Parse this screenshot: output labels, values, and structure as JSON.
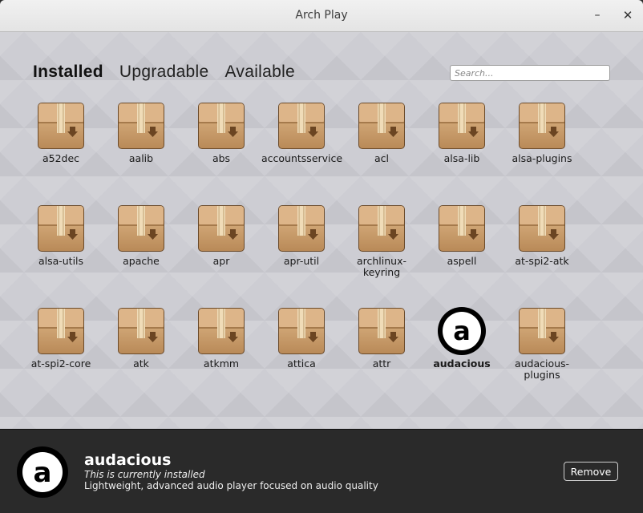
{
  "window": {
    "title": "Arch Play",
    "minimize_label": "–",
    "close_label": "✕"
  },
  "tabs": [
    {
      "label": "Installed",
      "active": true
    },
    {
      "label": "Upgradable",
      "active": false
    },
    {
      "label": "Available",
      "active": false
    }
  ],
  "search": {
    "placeholder": "Search..."
  },
  "packages": [
    {
      "name": "a52dec",
      "icon": "package-box-icon"
    },
    {
      "name": "aalib",
      "icon": "package-box-icon"
    },
    {
      "name": "abs",
      "icon": "package-box-icon"
    },
    {
      "name": "accountsservice",
      "icon": "package-box-icon"
    },
    {
      "name": "acl",
      "icon": "package-box-icon"
    },
    {
      "name": "alsa-lib",
      "icon": "package-box-icon"
    },
    {
      "name": "alsa-plugins",
      "icon": "package-box-icon"
    },
    {
      "name": "alsa-utils",
      "icon": "package-box-icon"
    },
    {
      "name": "apache",
      "icon": "package-box-icon"
    },
    {
      "name": "apr",
      "icon": "package-box-icon"
    },
    {
      "name": "apr-util",
      "icon": "package-box-icon"
    },
    {
      "name": "archlinux-\nkeyring",
      "icon": "package-box-icon"
    },
    {
      "name": "aspell",
      "icon": "package-box-icon"
    },
    {
      "name": "at-spi2-atk",
      "icon": "package-box-icon"
    },
    {
      "name": "at-spi2-core",
      "icon": "package-box-icon"
    },
    {
      "name": "atk",
      "icon": "package-box-icon"
    },
    {
      "name": "atkmm",
      "icon": "package-box-icon"
    },
    {
      "name": "attica",
      "icon": "package-box-icon"
    },
    {
      "name": "attr",
      "icon": "package-box-icon"
    },
    {
      "name": "audacious",
      "icon": "audacious-logo-icon",
      "selected": true
    },
    {
      "name": "audacious-\nplugins",
      "icon": "package-box-icon"
    }
  ],
  "details": {
    "name": "audacious",
    "status": "This is currently installed",
    "description": "Lightweight, advanced audio player focused on audio quality",
    "icon": "audacious-logo-icon",
    "remove_label": "Remove"
  }
}
